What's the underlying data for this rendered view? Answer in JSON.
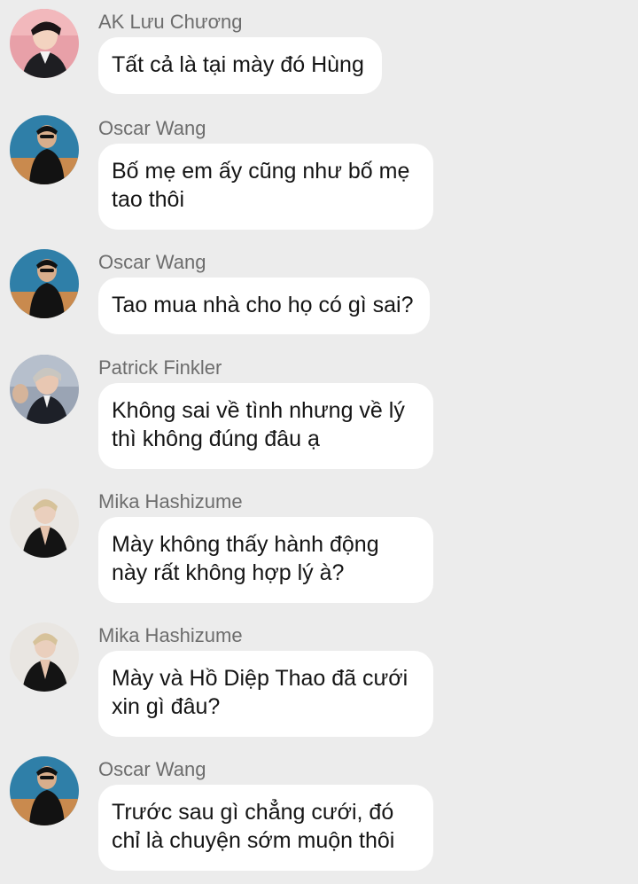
{
  "messages": [
    {
      "sender": "AK Lưu Chương",
      "avatar": "avatar-ak-luu-chuong",
      "lines": [
        "Tất cả là tại mày đó Hùng"
      ]
    },
    {
      "sender": "Oscar Wang",
      "avatar": "avatar-oscar-wang",
      "lines": [
        "Bố mẹ em ấy cũng như bố mẹ",
        "tao thôi"
      ]
    },
    {
      "sender": "Oscar Wang",
      "avatar": "avatar-oscar-wang",
      "lines": [
        "Tao mua nhà cho họ có gì sai?"
      ]
    },
    {
      "sender": "Patrick Finkler",
      "avatar": "avatar-patrick-finkler",
      "lines": [
        "Không sai về tình nhưng về lý",
        "thì không đúng đâu ạ"
      ]
    },
    {
      "sender": "Mika Hashizume",
      "avatar": "avatar-mika-hashizume",
      "lines": [
        "Mày không thấy hành động",
        "này rất không hợp lý à?"
      ]
    },
    {
      "sender": "Mika Hashizume",
      "avatar": "avatar-mika-hashizume",
      "lines": [
        "Mày và Hồ Diệp Thao đã cưới",
        "xin gì đâu?"
      ]
    },
    {
      "sender": "Oscar Wang",
      "avatar": "avatar-oscar-wang",
      "lines": [
        "Trước sau gì chẳng cưới, đó",
        "chỉ là chuyện sớm muộn thôi"
      ]
    }
  ]
}
